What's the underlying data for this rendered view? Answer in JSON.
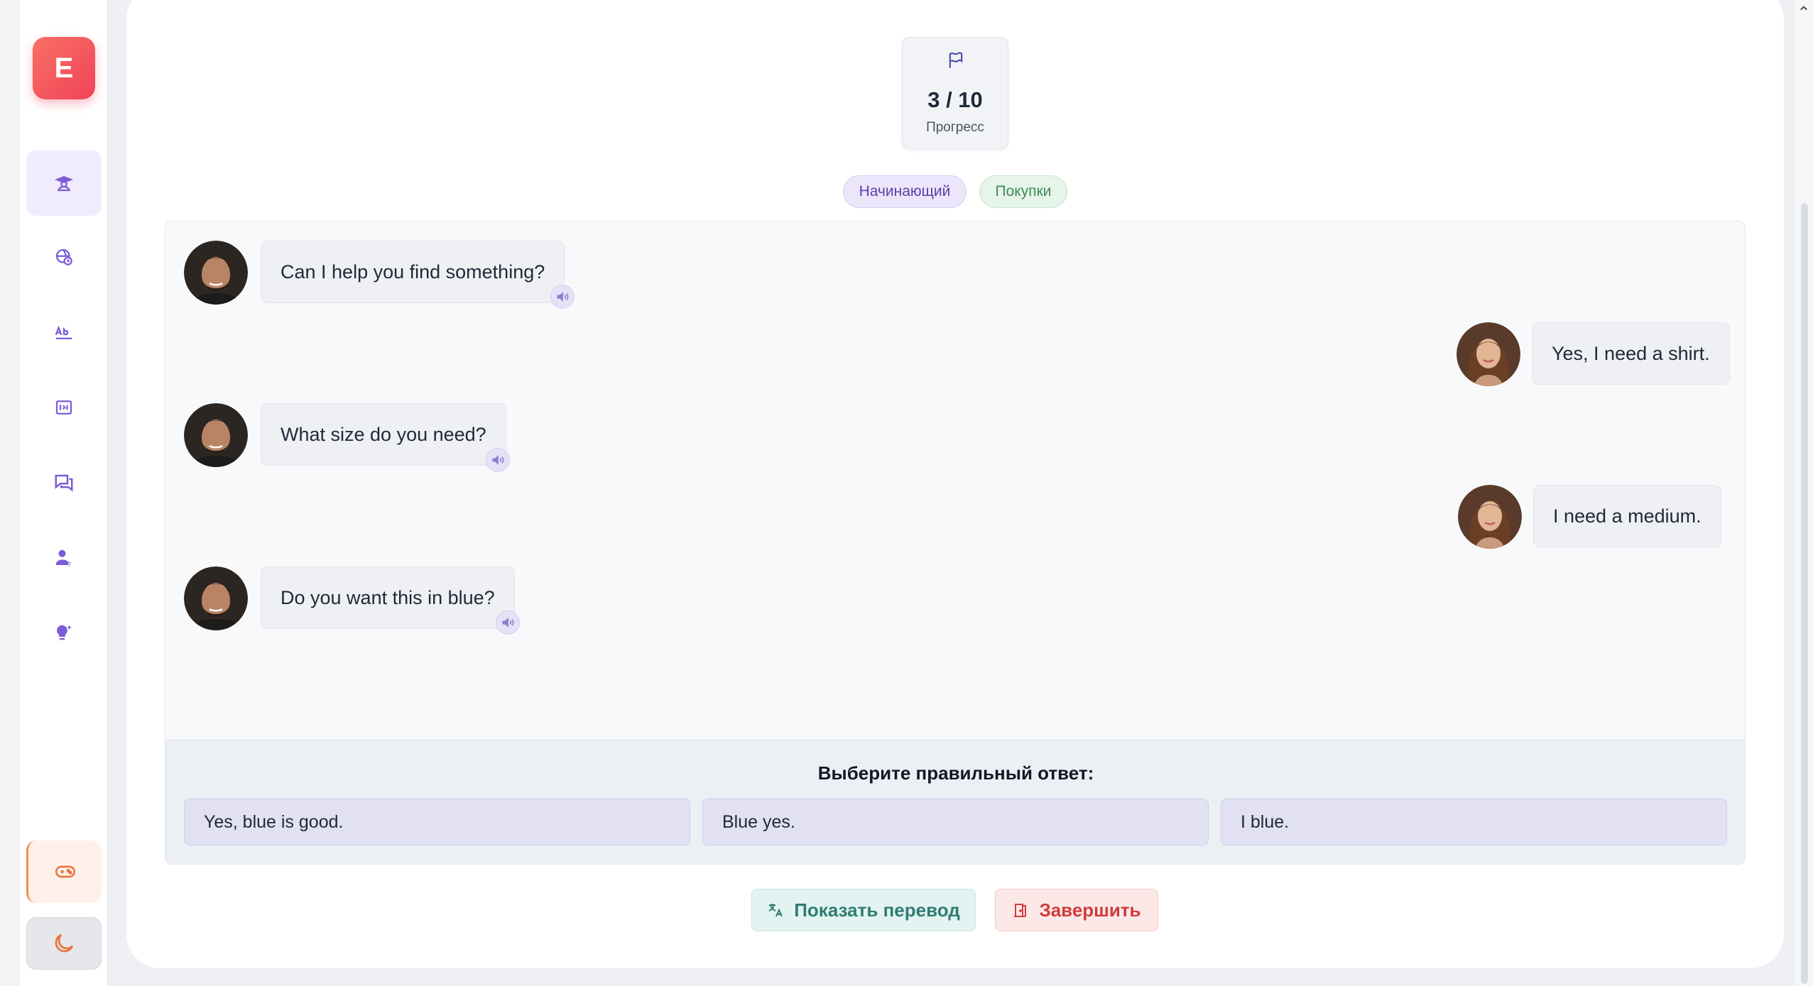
{
  "app": {
    "logo_letter": "E"
  },
  "sidebar": {
    "items": [
      {
        "icon": "student-icon",
        "active": true
      },
      {
        "icon": "globe-clock-icon",
        "active": false
      },
      {
        "icon": "spelling-icon",
        "active": false
      },
      {
        "icon": "flashcard-audio-icon",
        "active": false
      },
      {
        "icon": "chat-icon",
        "active": false
      },
      {
        "icon": "person-question-icon",
        "active": false
      },
      {
        "icon": "idea-icon",
        "active": false
      }
    ],
    "game_icon": "gamepad-icon",
    "theme_icon": "moon-icon"
  },
  "progress": {
    "value": "3 / 10",
    "label": "Прогресс"
  },
  "tags": {
    "level": "Начинающий",
    "topic": "Покупки"
  },
  "messages": [
    {
      "speaker": "seller",
      "text": "Can I help you find something?"
    },
    {
      "speaker": "customer",
      "text": "Yes, I need a shirt."
    },
    {
      "speaker": "seller",
      "text": "What size do you need?"
    },
    {
      "speaker": "customer",
      "text": "I need a medium."
    },
    {
      "speaker": "seller",
      "text": "Do you want this in blue?"
    }
  ],
  "quiz": {
    "prompt": "Выберите правильный ответ:",
    "options": [
      "Yes, blue is good.",
      "Blue yes.",
      "I blue."
    ]
  },
  "actions": {
    "translate_label": "Показать перевод",
    "finish_label": "Завершить"
  },
  "colors": {
    "brand": "#f04358",
    "accent_purple": "#7c5cd6",
    "option_bg": "#e2e1f4",
    "translate": "#2f7d73",
    "finish": "#d03c3c"
  }
}
